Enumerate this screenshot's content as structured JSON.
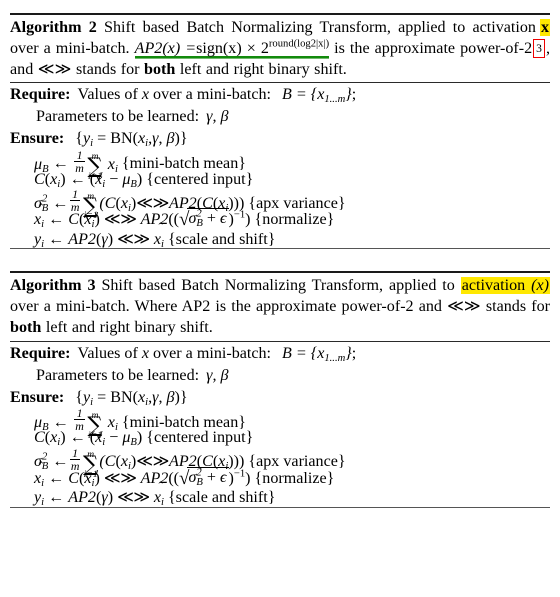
{
  "document": {
    "type": "algorithm-pseudocode-page",
    "colors": {
      "highlight_yellow": "#ffe800",
      "underline_green": "#128a0c",
      "box_red": "#ee0000",
      "text": "#000000",
      "background": "#ffffff"
    }
  },
  "algorithms": [
    {
      "id": "algorithm-2",
      "label": "Algorithm 2",
      "caption_parts": {
        "title": "Shift based Batch Normalizing Transform,",
        "applied_to": "applied to activation",
        "highlighted_token": "x",
        "over_minibatch": "over a mini-batch.",
        "ap2_lhs": "AP2(x) =",
        "ap2_rhs_sign": "sign(x) × 2",
        "ap2_exponent": "round(log2|x|)",
        "is_approx": "is the approximate power-of-2",
        "footnote_marker": "3",
        "tail": ", and ≪≫ stands for",
        "both": "both",
        "tail2": "left and right binary shift."
      },
      "require": {
        "keyword": "Require:",
        "text": "Values of x over a mini-batch:",
        "set": "B = {x",
        "set_sub": "1...m",
        "set_close": "};"
      },
      "params_line": {
        "text": "Parameters to be learned:",
        "symbols": "γ, β"
      },
      "ensure": {
        "keyword": "Ensure:",
        "body_open": "{y",
        "body_sub": "i",
        "body_eq": "= BN(x",
        "body_sub2": "i",
        "body_args": ",γ, β)}"
      },
      "steps": [
        {
          "lhs": "μ",
          "lhs_sub": "B",
          "arrow": "←",
          "frac_num": "1",
          "frac_den": "m",
          "sum_top": "m",
          "sum_bot": "i=1",
          "operand": "x",
          "operand_sub": "i",
          "comment": "{mini-batch mean}"
        },
        {
          "lhs": "C(x",
          "lhs_sub": "i",
          "lhs_close": ")",
          "arrow": "←",
          "body": "(x",
          "body_sub": "i",
          "body_rest": "− μ",
          "body_sub2": "B",
          "body_close": ")",
          "comment": "{centered input}"
        },
        {
          "lhs": "σ",
          "lhs_sup": "2",
          "lhs_sub": "B",
          "arrow": "←",
          "frac_num": "1",
          "frac_den": "m",
          "sum_top": "m",
          "sum_bot": "i=1",
          "body": "(C(x",
          "body_sub": "i",
          "shift": "≪≫",
          "body_ap2": "AP2(C(x",
          "body_sub2": "i",
          "body_close": ")))",
          "comment": "{apx variance}"
        },
        {
          "lhs_hat": "x",
          "lhs_sub": "i",
          "arrow": "←",
          "body": "C(x",
          "body_sub": "i",
          "body_close": ")",
          "shift": "≪≫",
          "ap2_open": "AP2((",
          "sqrt_body": "σ",
          "sqrt_sup": "2",
          "sqrt_sub": "B",
          "sqrt_rest": "+ ϵ",
          "inv": "−1",
          "close": ")",
          "comment": "{normalize}"
        },
        {
          "lhs": "y",
          "lhs_sub": "i",
          "arrow": "←",
          "body": "AP2(γ)",
          "shift": "≪≫",
          "rhs_hat": "x",
          "rhs_sub": "i",
          "comment": "{scale and shift}"
        }
      ]
    },
    {
      "id": "algorithm-3",
      "label": "Algorithm 3",
      "caption_parts": {
        "title": "Shift based Batch Normalizing Transform,",
        "applied_to": "applied to",
        "highlighted_phrase": "activation (x)",
        "over_minibatch": "over a mini-batch. Where AP2 is",
        "line3a": "the approximate power-of-2 and ≪≫ stands for",
        "both": "both",
        "line3b": "left",
        "line4": "and right binary shift."
      },
      "require": {
        "keyword": "Require:",
        "text": "Values of x over a mini-batch:",
        "set": "B = {x",
        "set_sub": "1...m",
        "set_close": "};"
      },
      "params_line": {
        "text": "Parameters to be learned:",
        "symbols": "γ, β"
      },
      "ensure": {
        "keyword": "Ensure:",
        "body_open": "{y",
        "body_sub": "i",
        "body_eq": "= BN(x",
        "body_sub2": "i",
        "body_args": ",γ, β)}"
      },
      "steps": [
        {
          "lhs": "μ",
          "lhs_sub": "B",
          "arrow": "←",
          "frac_num": "1",
          "frac_den": "m",
          "sum_top": "m",
          "sum_bot": "i=1",
          "operand": "x",
          "operand_sub": "i",
          "comment": "{mini-batch mean}"
        },
        {
          "lhs": "C(x",
          "lhs_sub": "i",
          "lhs_close": ")",
          "arrow": "←",
          "body": "(x",
          "body_sub": "i",
          "body_rest": "− μ",
          "body_sub2": "B",
          "body_close": ")",
          "comment": "{centered input}"
        },
        {
          "lhs": "σ",
          "lhs_sup": "2",
          "lhs_sub": "B",
          "arrow": "←",
          "frac_num": "1",
          "frac_den": "m",
          "sum_top": "m",
          "sum_bot": "i=1",
          "body": "(C(x",
          "body_sub": "i",
          "shift": "≪≫",
          "body_ap2": "AP2(C(x",
          "body_sub2": "i",
          "body_close": ")))",
          "comment": "{apx variance}"
        },
        {
          "lhs_hat": "x",
          "lhs_sub": "i",
          "arrow": "←",
          "body": "C(x",
          "body_sub": "i",
          "body_close": ")",
          "shift": "≪≫",
          "ap2_open": "AP2((",
          "sqrt_body": "σ",
          "sqrt_sup": "2",
          "sqrt_sub": "B",
          "sqrt_rest": "+ ϵ",
          "inv": "−1",
          "close": ")",
          "comment": "{normalize}"
        },
        {
          "lhs": "y",
          "lhs_sub": "i",
          "arrow": "←",
          "body": "AP2(γ)",
          "shift": "≪≫",
          "rhs_hat": "x",
          "rhs_sub": "i",
          "comment": "{scale and shift}"
        }
      ]
    }
  ]
}
